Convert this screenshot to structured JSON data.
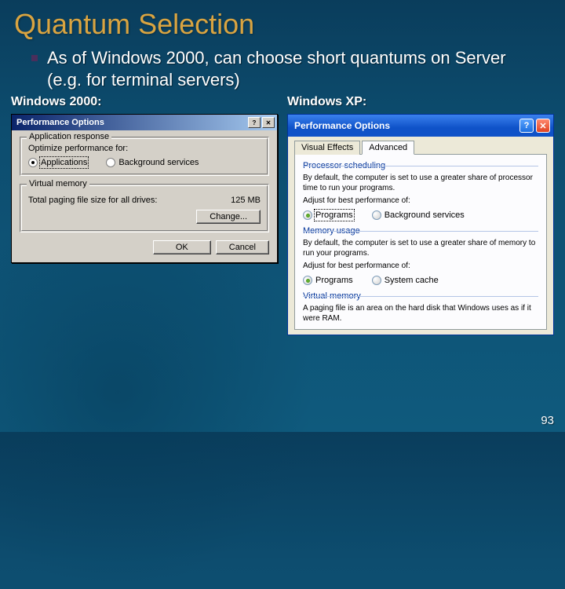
{
  "title": "Quantum Selection",
  "bullet": "As of Windows 2000, can choose short quantums on Server (e.g. for terminal servers)",
  "left_heading": "Windows 2000:",
  "right_heading": "Windows XP:",
  "page_number": "93",
  "win2k": {
    "window_title": "Performance Options",
    "app_response": "Application response",
    "optimize_for": "Optimize performance for:",
    "opt_applications": "Applications",
    "opt_background": "Background services",
    "virtual_memory": "Virtual memory",
    "paging_label": "Total paging file size for all drives:",
    "paging_value": "125 MB",
    "change_button": "Change...",
    "ok_button": "OK",
    "cancel_button": "Cancel"
  },
  "winxp": {
    "window_title": "Performance Options",
    "tab_visual": "Visual Effects",
    "tab_advanced": "Advanced",
    "proc_sched": "Processor scheduling",
    "proc_desc": "By default, the computer is set to use a greater share of processor time to run your programs.",
    "adjust_label": "Adjust for best performance of:",
    "opt_programs": "Programs",
    "opt_background": "Background services",
    "mem_usage": "Memory usage",
    "mem_desc": "By default, the computer is set to use a greater share of memory to run your programs.",
    "opt_programs2": "Programs",
    "opt_syscache": "System cache",
    "virtual_memory": "Virtual memory",
    "vm_desc": "A paging file is an area on the hard disk that Windows uses as if it were RAM."
  }
}
